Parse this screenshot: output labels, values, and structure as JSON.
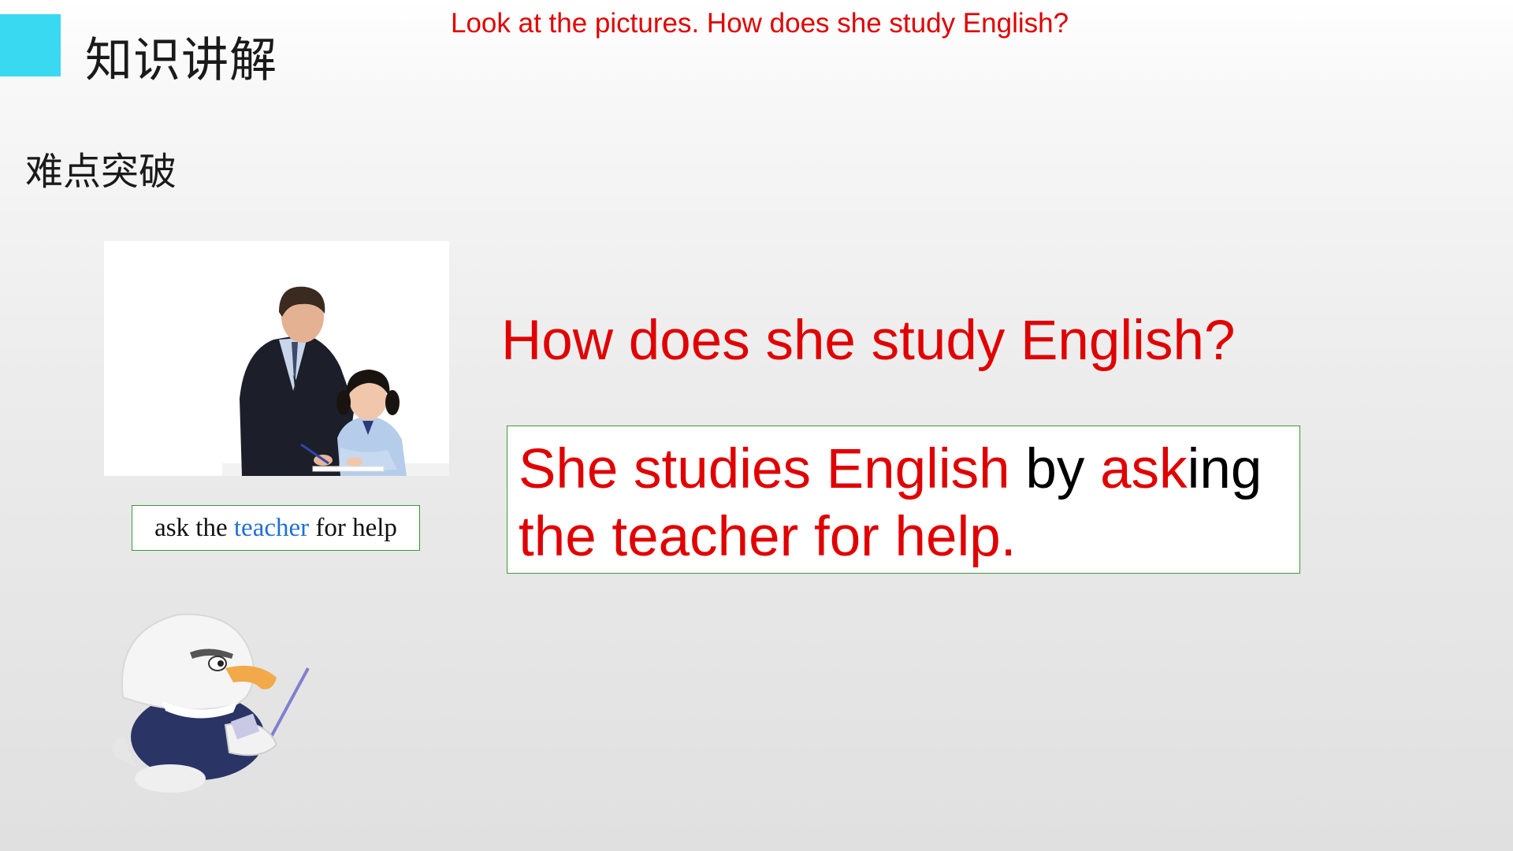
{
  "header": {
    "title": "知识讲解"
  },
  "prompt": {
    "text": "Look at the pictures. How does she study English?"
  },
  "section": {
    "title": "难点突破"
  },
  "phrase": {
    "part1": "ask the ",
    "highlight": "teacher",
    "part2": " for help"
  },
  "question": {
    "text": "How does she study English?"
  },
  "answer": {
    "red1": "She studies English ",
    "black1": "by ",
    "red2": "ask",
    "black2": "ing",
    "red3": "the teacher for help."
  },
  "colors": {
    "accent": "#3ad9f2",
    "red": "#e00000",
    "highlight_blue": "#1f6fd6",
    "box_border": "#3a9a3a"
  },
  "icons": {
    "photo": "teacher-helping-girl-illustration",
    "mascot": "eagle-mascot-illustration"
  }
}
